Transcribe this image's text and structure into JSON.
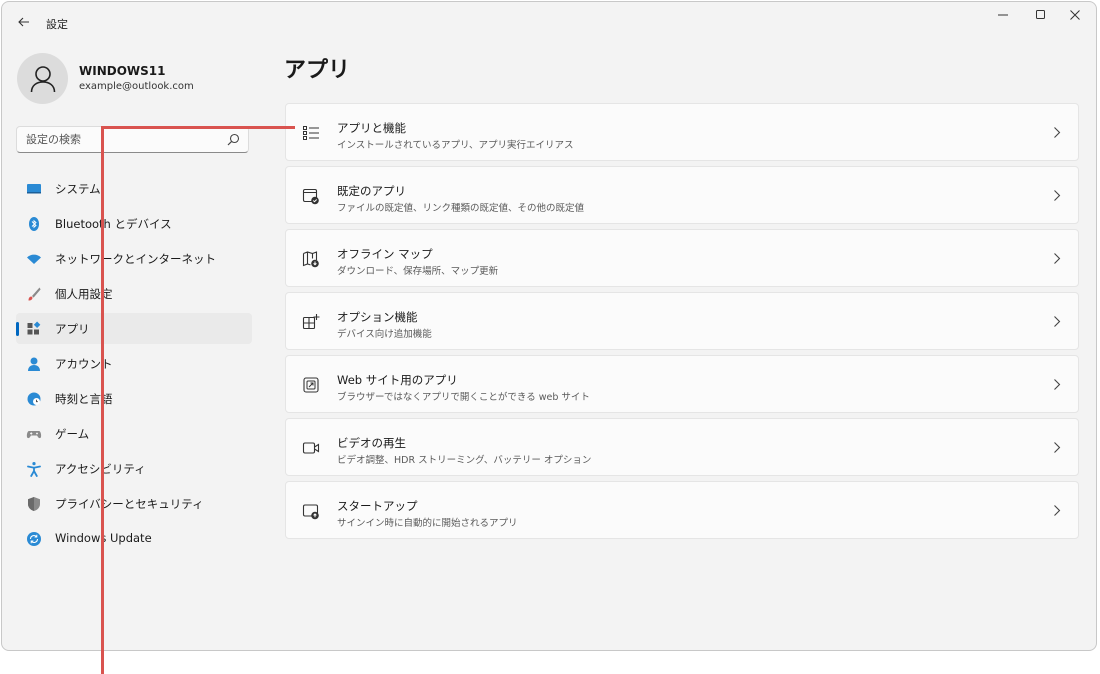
{
  "window": {
    "title": "設定"
  },
  "profile": {
    "name": "WINDOWS11",
    "email": "example@outlook.com"
  },
  "search": {
    "placeholder": "設定の検索"
  },
  "sidebar": {
    "items": [
      {
        "label": "システム",
        "icon": "monitor-icon"
      },
      {
        "label": "Bluetooth とデバイス",
        "icon": "bluetooth-icon"
      },
      {
        "label": "ネットワークとインターネット",
        "icon": "wifi-icon"
      },
      {
        "label": "個人用設定",
        "icon": "brush-icon"
      },
      {
        "label": "アプリ",
        "icon": "apps-icon",
        "selected": true
      },
      {
        "label": "アカウント",
        "icon": "account-icon"
      },
      {
        "label": "時刻と言語",
        "icon": "globe-clock-icon"
      },
      {
        "label": "ゲーム",
        "icon": "gamepad-icon"
      },
      {
        "label": "アクセシビリティ",
        "icon": "accessibility-icon"
      },
      {
        "label": "プライバシーとセキュリティ",
        "icon": "shield-icon"
      },
      {
        "label": "Windows Update",
        "icon": "update-icon"
      }
    ]
  },
  "main": {
    "title": "アプリ",
    "cards": [
      {
        "title": "アプリと機能",
        "subtitle": "インストールされているアプリ、アプリ実行エイリアス",
        "icon": "list-icon"
      },
      {
        "title": "既定のアプリ",
        "subtitle": "ファイルの既定値、リンク種類の既定値、その他の既定値",
        "icon": "default-apps-icon"
      },
      {
        "title": "オフライン マップ",
        "subtitle": "ダウンロード、保存場所、マップ更新",
        "icon": "offline-map-icon"
      },
      {
        "title": "オプション機能",
        "subtitle": "デバイス向け追加機能",
        "icon": "add-feature-icon"
      },
      {
        "title": "Web サイト用のアプリ",
        "subtitle": "ブラウザーではなくアプリで開くことができる web サイト",
        "icon": "open-link-icon"
      },
      {
        "title": "ビデオの再生",
        "subtitle": "ビデオ調整、HDR ストリーミング、バッテリー オプション",
        "icon": "video-icon"
      },
      {
        "title": "スタートアップ",
        "subtitle": "サインイン時に自動的に開始されるアプリ",
        "icon": "startup-icon"
      }
    ]
  },
  "colors": {
    "accent": "#0067c0",
    "annotation": "#d9534f"
  }
}
